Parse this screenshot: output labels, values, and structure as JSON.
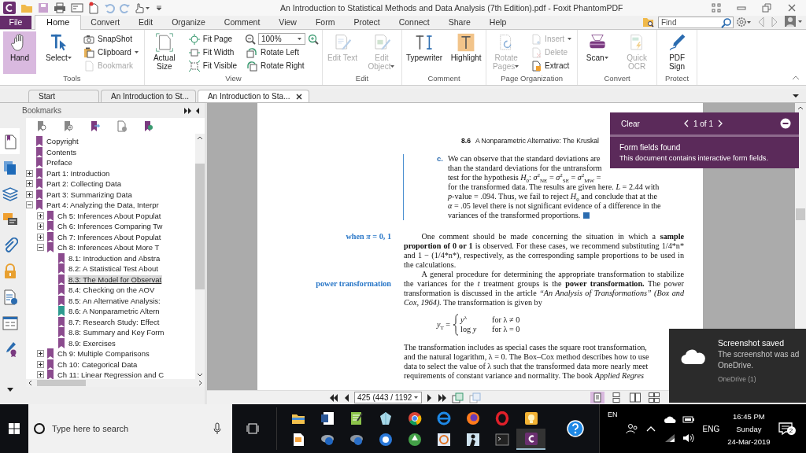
{
  "window": {
    "title": "An Introduction to Statistical Methods and Data Analysis (7th Edition).pdf - Foxit PhantomPDF"
  },
  "menu_tabs": [
    {
      "label": "File",
      "kind": "file",
      "selected": false
    },
    {
      "label": "Home",
      "kind": "tab",
      "selected": true
    },
    {
      "label": "Convert",
      "kind": "tab",
      "selected": false
    },
    {
      "label": "Edit",
      "kind": "tab",
      "selected": false
    },
    {
      "label": "Organize",
      "kind": "tab",
      "selected": false
    },
    {
      "label": "Comment",
      "kind": "tab",
      "selected": false
    },
    {
      "label": "View",
      "kind": "tab",
      "selected": false
    },
    {
      "label": "Form",
      "kind": "tab",
      "selected": false
    },
    {
      "label": "Protect",
      "kind": "tab",
      "selected": false
    },
    {
      "label": "Connect",
      "kind": "tab",
      "selected": false
    },
    {
      "label": "Share",
      "kind": "tab",
      "selected": false
    },
    {
      "label": "Help",
      "kind": "tab",
      "selected": false
    }
  ],
  "find": {
    "placeholder": "Find"
  },
  "ribbon": [
    {
      "label": "Tools",
      "items": [
        {
          "kind": "large",
          "label": "Hand",
          "selected": true,
          "disabled": false,
          "dropdown": false
        },
        {
          "kind": "large",
          "label": "Select",
          "selected": false,
          "disabled": false,
          "dropdown": true
        },
        {
          "kind": "small",
          "label": "SnapShot",
          "selected": false,
          "disabled": false,
          "dropdown": false
        },
        {
          "kind": "small",
          "label": "Clipboard",
          "selected": false,
          "disabled": false,
          "dropdown": true
        },
        {
          "kind": "small",
          "label": "Bookmark",
          "selected": false,
          "disabled": true,
          "dropdown": false
        }
      ]
    },
    {
      "label": "View",
      "items": [
        {
          "kind": "large",
          "label": "Actual Size",
          "selected": false,
          "disabled": false,
          "dropdown": false
        },
        {
          "kind": "small",
          "label": "Fit Page",
          "selected": false,
          "disabled": false,
          "dropdown": false
        },
        {
          "kind": "small",
          "label": "Fit Width",
          "selected": false,
          "disabled": false,
          "dropdown": false
        },
        {
          "kind": "small",
          "label": "Fit Visible",
          "selected": false,
          "disabled": false,
          "dropdown": false
        },
        {
          "kind": "zoom",
          "label": "100%",
          "selected": false,
          "disabled": false,
          "dropdown": true
        },
        {
          "kind": "small",
          "label": "Rotate Left",
          "selected": false,
          "disabled": false,
          "dropdown": false
        },
        {
          "kind": "small",
          "label": "Rotate Right",
          "selected": false,
          "disabled": false,
          "dropdown": false
        }
      ]
    },
    {
      "label": "Edit",
      "items": [
        {
          "kind": "large",
          "label": "Edit Text",
          "selected": false,
          "disabled": true,
          "dropdown": false
        },
        {
          "kind": "large",
          "label": "Edit Object",
          "selected": false,
          "disabled": true,
          "dropdown": true
        }
      ]
    },
    {
      "label": "Comment",
      "items": [
        {
          "kind": "large",
          "label": "Typewriter",
          "selected": false,
          "disabled": false,
          "dropdown": false
        },
        {
          "kind": "large",
          "label": "Highlight",
          "selected": false,
          "disabled": false,
          "dropdown": false
        }
      ]
    },
    {
      "label": "Page Organization",
      "items": [
        {
          "kind": "large",
          "label": "Rotate Pages",
          "selected": false,
          "disabled": true,
          "dropdown": true
        },
        {
          "kind": "small",
          "label": "Insert",
          "selected": false,
          "disabled": true,
          "dropdown": true
        },
        {
          "kind": "small",
          "label": "Delete",
          "selected": false,
          "disabled": true,
          "dropdown": false
        },
        {
          "kind": "small",
          "label": "Extract",
          "selected": false,
          "disabled": false,
          "dropdown": false
        }
      ]
    },
    {
      "label": "Convert",
      "items": [
        {
          "kind": "large",
          "label": "Scan",
          "selected": false,
          "disabled": false,
          "dropdown": true
        },
        {
          "kind": "large",
          "label": "Quick OCR",
          "selected": false,
          "disabled": true,
          "dropdown": false
        }
      ]
    },
    {
      "label": "Protect",
      "items": [
        {
          "kind": "large",
          "label": "PDF Sign",
          "selected": false,
          "disabled": false,
          "dropdown": false
        }
      ]
    }
  ],
  "doc_tabs": [
    {
      "label": "Start",
      "selected": false
    },
    {
      "label": "An Introduction to St...",
      "selected": false
    },
    {
      "label": "An Introduction to Sta...",
      "selected": true
    }
  ],
  "side_rail": [
    {
      "selected": true
    },
    {
      "selected": false
    },
    {
      "selected": false
    },
    {
      "selected": false
    },
    {
      "selected": false
    },
    {
      "selected": false
    },
    {
      "selected": false
    },
    {
      "selected": false
    },
    {
      "selected": false
    }
  ],
  "bookmarks": {
    "title": "Bookmarks",
    "items": [
      {
        "label": "Copyright",
        "kind": "leaf",
        "selected": false,
        "color": "#8b4b8e"
      },
      {
        "label": "Contents",
        "kind": "leaf",
        "selected": false,
        "color": "#8b4b8e"
      },
      {
        "label": "Preface",
        "kind": "leaf",
        "selected": false,
        "color": "#8b4b8e"
      },
      {
        "label": "Part 1: Introduction",
        "kind": "branch",
        "expanded": false,
        "selected": false,
        "color": "#8b4b8e"
      },
      {
        "label": "Part 2: Collecting Data",
        "kind": "branch",
        "expanded": false,
        "selected": false,
        "color": "#8b4b8e"
      },
      {
        "label": "Part 3: Summarizing Data",
        "kind": "branch",
        "expanded": false,
        "selected": false,
        "color": "#8b4b8e"
      },
      {
        "label": "Part 4: Analyzing the Data, Interpr",
        "kind": "branch",
        "expanded": true,
        "selected": false,
        "color": "#8b4b8e",
        "children": [
          {
            "label": "Ch 5: Inferences About Populat",
            "kind": "branch",
            "expanded": false,
            "selected": false,
            "color": "#8b4b8e"
          },
          {
            "label": "Ch 6: Inferences Comparing Tw",
            "kind": "branch",
            "expanded": false,
            "selected": false,
            "color": "#8b4b8e"
          },
          {
            "label": "Ch 7: Inferences About Populat",
            "kind": "branch",
            "expanded": false,
            "selected": false,
            "color": "#8b4b8e"
          },
          {
            "label": "Ch 8: Inferences About More T",
            "kind": "branch",
            "expanded": true,
            "selected": false,
            "color": "#8b4b8e",
            "children": [
              {
                "label": "8.1: Introduction and Abstra",
                "kind": "leaf",
                "selected": false,
                "color": "#8b4b8e"
              },
              {
                "label": "8.2: A Statistical Test About",
                "kind": "leaf",
                "selected": false,
                "color": "#8b4b8e"
              },
              {
                "label": "8.3: The Model for Observat",
                "kind": "leaf",
                "selected": true,
                "color": "#8b4b8e"
              },
              {
                "label": "8.4: Checking on the AOV",
                "kind": "leaf",
                "selected": false,
                "color": "#8b4b8e"
              },
              {
                "label": "8.5: An Alternative Analysis:",
                "kind": "leaf",
                "selected": false,
                "color": "#8b4b8e"
              },
              {
                "label": "8.6: A Nonparametric Altern",
                "kind": "leaf",
                "selected": false,
                "color": "#2e9a8f"
              },
              {
                "label": "8.7: Research Study: Effect",
                "kind": "leaf",
                "selected": false,
                "color": "#8b4b8e"
              },
              {
                "label": "8.8: Summary and Key Form",
                "kind": "leaf",
                "selected": false,
                "color": "#8b4b8e"
              },
              {
                "label": "8.9: Exercises",
                "kind": "leaf",
                "selected": false,
                "color": "#8b4b8e"
              }
            ]
          },
          {
            "label": "Ch 9: Multiple Comparisons",
            "kind": "branch",
            "expanded": false,
            "selected": false,
            "color": "#8b4b8e"
          },
          {
            "label": "Ch 10: Categorical Data",
            "kind": "branch",
            "expanded": false,
            "selected": false,
            "color": "#8b4b8e"
          },
          {
            "label": "Ch 11: Linear Regression and C",
            "kind": "branch",
            "expanded": false,
            "selected": false,
            "color": "#8b4b8e"
          }
        ]
      }
    ]
  },
  "page": {
    "section_number": "8.6",
    "running_head": "A Nonparametric Alternative: The Kruskal",
    "item_label": "c.",
    "item_lines": [
      "We can observe that the standard deviations are",
      "than the standard deviations for the untransform",
      "test for the hypothesis *H*$_{0}$: *σ*$^{2}$$_{NE}$ = *σ*$^{2}$$_{SE}$ = *σ*$^{2}$$_{MW}$ =",
      "for the transformed data. The results are given here. *L* = 2.44 with",
      "*p*-value = .094. Thus, we fail to reject *H*$_{0}$ and conclude that at the",
      "*α* = .05 level there is not significant evidence of a difference in the",
      "variances of the transformed proportions."
    ],
    "margin_notes": [
      "when *π* = 0, 1",
      "power transformation"
    ],
    "paragraphs": [
      "One comment should be made concerning the situation in which a **sample proportion of 0 or 1** is observed. For these cases, we recommend substituting 1/4*n* and 1 − (1/4*n*), respectively, as the corresponding sample proportions to be used in the calculations.",
      "A general procedure for determining the appropriate transformation to stabilize the variances for the *t* treatment groups is the **power transformation.** The power transformation is discussed in the article *“An Analysis of Transformations” (Box and Cox, 1964).* The transformation is given by"
    ],
    "equation": {
      "lhs": "*y*$_{T}$ =",
      "cases": [
        {
          "expr": "*y*$^{λ}$",
          "condition": "for λ ≠ 0"
        },
        {
          "expr": "log *y*",
          "condition": "for λ = 0"
        }
      ]
    },
    "closing_lines": [
      "The transformation includes as special cases the square root transformation,",
      "and the natural logarithm, λ = 0. The Box–Cox method describes how to use",
      "data to select the value of λ such that the transformed data more nearly meet",
      "requirements of constant variance and normality. The book *Applied Regres*"
    ]
  },
  "status_bar": {
    "page_field": "425 (443 / 1192",
    "view_modes": [
      {
        "selected": true
      },
      {
        "selected": false
      },
      {
        "selected": false
      },
      {
        "selected": false
      }
    ]
  },
  "form_popup": {
    "clear": "Clear",
    "counter": "1 of 1",
    "title": "Form fields found",
    "message": "This document contains interactive form fields."
  },
  "toast": {
    "title": "Screenshot saved",
    "lines": [
      "The screenshot was ad",
      "OneDrive."
    ],
    "source": "OneDrive (1)"
  },
  "taskbar": {
    "search_placeholder": "Type here to search",
    "input_language": "EN",
    "language": "ENG",
    "time": "16:45 PM",
    "day": "Sunday",
    "date": "24-Mar-2019",
    "notification_count": "2"
  }
}
